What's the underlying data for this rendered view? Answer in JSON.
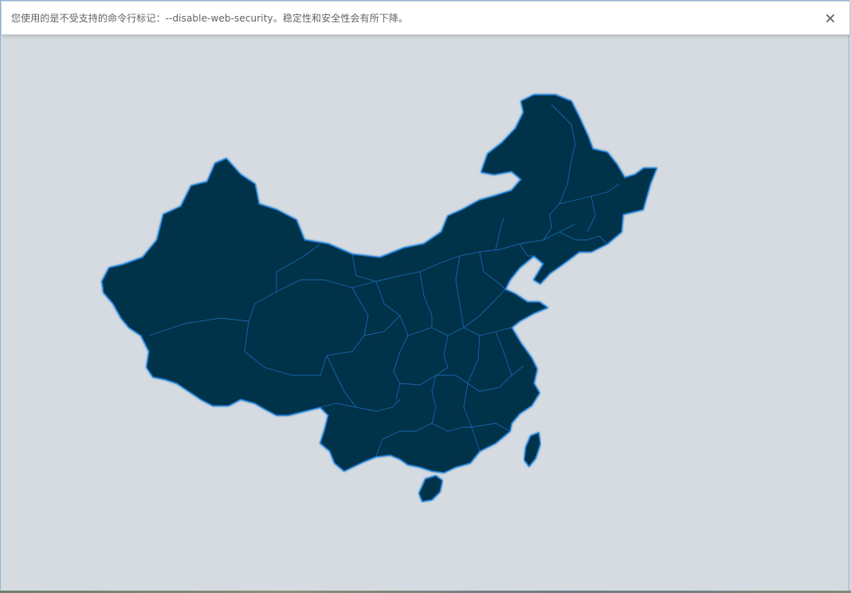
{
  "infobar": {
    "message": "您使用的是不受支持的命令行标记：--disable-web-security。稳定性和安全性会有所下降。",
    "close_icon": "close-icon"
  },
  "map": {
    "region": "China",
    "fill_color": "#03304a",
    "border_color": "#1f7fd6",
    "background_color": "#d5dbe0"
  }
}
